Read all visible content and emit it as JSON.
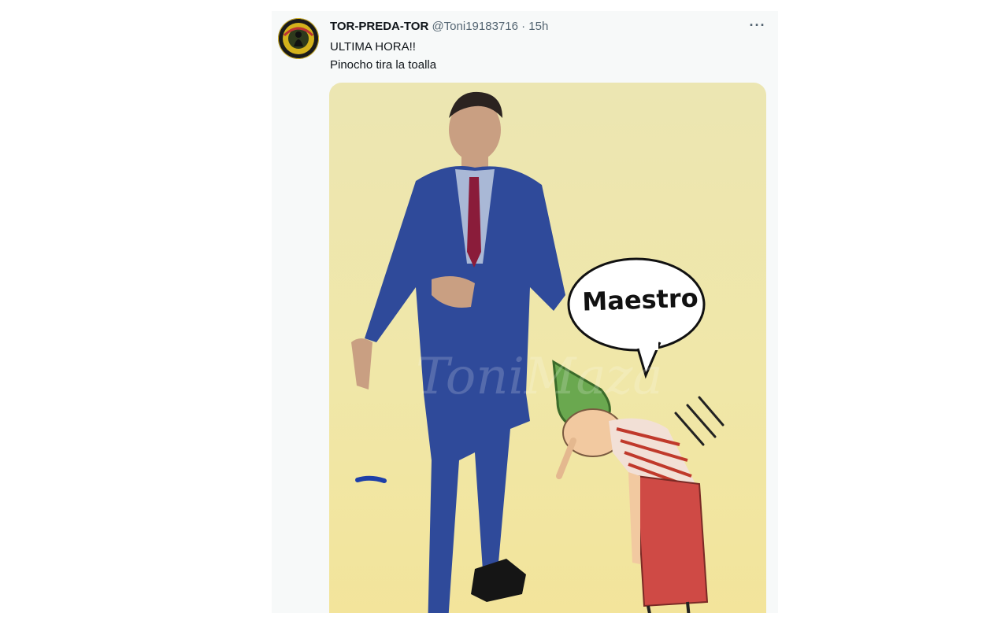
{
  "tweet": {
    "author_name": "TOR-PREDA-TOR",
    "author_handle": "@Toni19183716",
    "separator": "·",
    "time": "15h",
    "text_lines": [
      "ULTIMA HORA!!",
      "Pinocho tira la toalla"
    ],
    "more_icon": "more-horizontal-icon"
  },
  "media": {
    "speech_bubble_text": "Maestro"
  },
  "colors": {
    "name": "#0f1419",
    "meta": "#536471",
    "card_bg": "#f7f9f9",
    "suit": "#2f4a9a",
    "tie": "#8a1c3a",
    "hat": "#6aa84f",
    "shirt_stripes": "#c0392b"
  }
}
